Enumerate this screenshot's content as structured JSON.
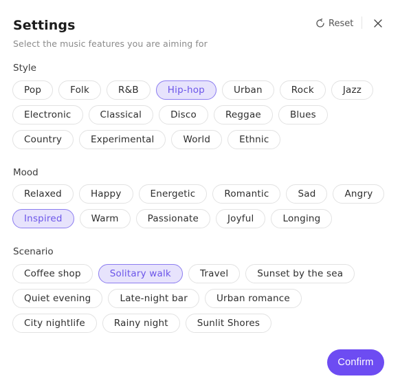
{
  "header": {
    "title": "Settings",
    "subtitle": "Select the music features you are aiming for",
    "reset_label": "Reset",
    "reset_icon": "reset-icon",
    "close_icon": "close-icon"
  },
  "sections": {
    "style": {
      "label": "Style",
      "options": [
        "Pop",
        "Folk",
        "R&B",
        "Hip-hop",
        "Urban",
        "Rock",
        "Jazz",
        "Electronic",
        "Classical",
        "Disco",
        "Reggae",
        "Blues",
        "Country",
        "Experimental",
        "World",
        "Ethnic"
      ],
      "selected": [
        "Hip-hop"
      ]
    },
    "mood": {
      "label": "Mood",
      "options": [
        "Relaxed",
        "Happy",
        "Energetic",
        "Romantic",
        "Sad",
        "Angry",
        "Inspired",
        "Warm",
        "Passionate",
        "Joyful",
        "Longing"
      ],
      "selected": [
        "Inspired"
      ]
    },
    "scenario": {
      "label": "Scenario",
      "options": [
        "Coffee shop",
        "Solitary walk",
        "Travel",
        "Sunset by the sea",
        "Quiet evening",
        "Late-night bar",
        "Urban romance",
        "City nightlife",
        "Rainy night",
        "Sunlit Shores"
      ],
      "selected": [
        "Solitary walk"
      ]
    }
  },
  "footer": {
    "confirm_label": "Confirm"
  },
  "colors": {
    "accent": "#6d4cf2",
    "selected_bg": "#e7e3fc",
    "selected_text": "#6b55e9",
    "chip_border": "#e2e2e2"
  }
}
